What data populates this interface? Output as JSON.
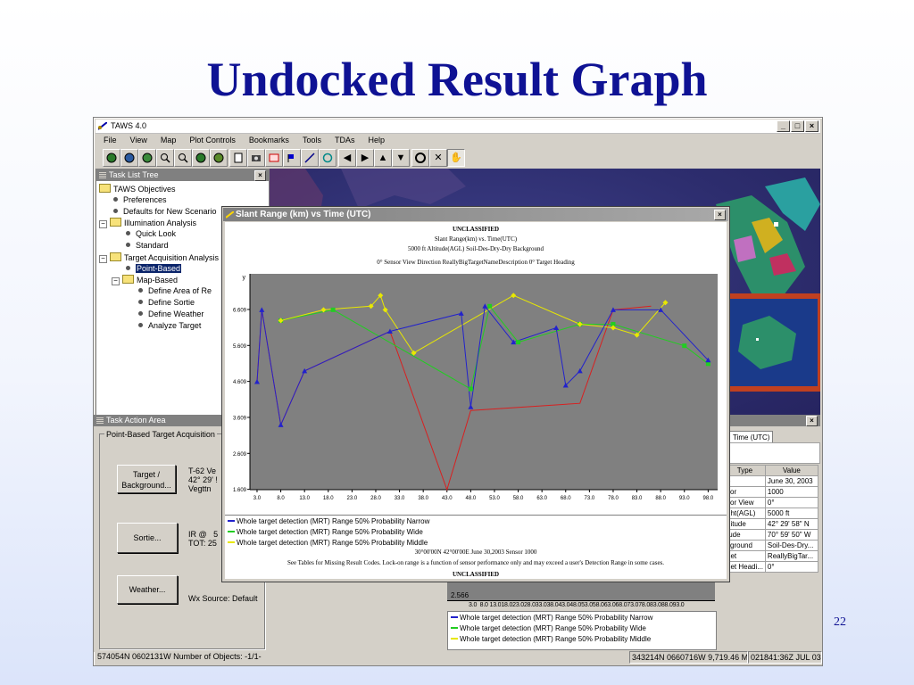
{
  "slide": {
    "title": "Undocked Result Graph",
    "page_number": "22"
  },
  "app": {
    "title": "TAWS 4.0",
    "menu": [
      "File",
      "View",
      "Map",
      "Plot Controls",
      "Bookmarks",
      "Tools",
      "TDAs",
      "Help"
    ],
    "toolbar_icons": [
      "globe-icon",
      "globe-icon",
      "globe-icon",
      "zoom-in-icon",
      "zoom-out-icon",
      "globe-icon",
      "globe-icon",
      "document-icon",
      "camera-icon",
      "measure-icon",
      "flag-icon",
      "arrow-line-icon",
      "circle-target-icon",
      "arrow-left-icon",
      "arrow-right-icon",
      "arrow-up-icon",
      "arrow-down-icon",
      "pan-cross-icon",
      "crosshair-icon",
      "hand-icon"
    ]
  },
  "task_list": {
    "title": "Task List Tree",
    "items": [
      {
        "label": "TAWS Objectives",
        "kind": "folder",
        "indent": 0
      },
      {
        "label": "Preferences",
        "kind": "leaf",
        "indent": 1
      },
      {
        "label": "Defaults for New Scenario",
        "kind": "leaf",
        "indent": 1
      },
      {
        "label": "Illumination Analysis",
        "kind": "folder-open",
        "indent": 0
      },
      {
        "label": "Quick Look",
        "kind": "leaf",
        "indent": 2
      },
      {
        "label": "Standard",
        "kind": "leaf",
        "indent": 2
      },
      {
        "label": "Target Acquisition Analysis",
        "kind": "folder-open",
        "indent": 0
      },
      {
        "label": "Point-Based",
        "kind": "leaf-selected",
        "indent": 2
      },
      {
        "label": "Map-Based",
        "kind": "folder-open",
        "indent": 1
      },
      {
        "label": "Define Area of Re",
        "kind": "leaf",
        "indent": 3
      },
      {
        "label": "Define Sortie",
        "kind": "leaf",
        "indent": 3
      },
      {
        "label": "Define Weather",
        "kind": "leaf",
        "indent": 3
      },
      {
        "label": "Analyze Target",
        "kind": "leaf",
        "indent": 3
      }
    ]
  },
  "task_action": {
    "title": "Task Action Area",
    "group_label": "Point-Based Target Acquisition",
    "target_button": "Target /\nBackground...",
    "target_info": "T-62 Ve\n42° 29' !\nVegttn",
    "sortie_button": "Sortie...",
    "sortie_info": "IR @   5\nTOT: 25",
    "weather_button": "Weather...",
    "weather_info": "Wx Source: Default"
  },
  "docked_graph": {
    "tab_label": "Time (UTC)",
    "table_headers": [
      "Type",
      "Value"
    ],
    "rows": [
      [
        "e",
        "June 30, 2003"
      ],
      [
        "sor",
        "1000"
      ],
      [
        "sor View",
        "0°"
      ],
      [
        "ght(AGL)",
        "5000 ft"
      ],
      [
        "gitude",
        "42° 29' 58\" N"
      ],
      [
        "tude",
        "70° 59' 50\" W"
      ],
      [
        "kground",
        "Soil-Des-Dry..."
      ],
      [
        "get",
        "ReallyBigTar..."
      ],
      [
        "get Headi...",
        "0°"
      ]
    ],
    "y_tick": "2.566",
    "x_ticks": "3.0  8.0 13.018.023.028.033.038.043.048.053.058.063.068.073.078.083.088.093.0",
    "legend": [
      "Whole target detection (MRT) Range  50% Probability  Narrow",
      "Whole target detection (MRT) Range  50% Probability  Wide",
      "Whole target detection (MRT) Range  50% Probability  Middle"
    ]
  },
  "graph_window": {
    "title": "Slant Range (km) vs Time (UTC)",
    "classification_top": "UNCLASSIFIED",
    "header_lines": [
      "Slant Range(km) vs. Time(UTC)",
      "5000 ft Altitude(AGL) Soil-Des-Dry-Dry Background",
      "0° Sensor View Direction ReallyBigTargetNameDescription 0° Target Heading"
    ],
    "footer_lines": [
      "30°00'00N 42°00'00E June 30,2003 Sensor 1000",
      "See Tables for Missing Result Codes. Lock-on range is a function of sensor performance only and may exceed a user's Detection Range in some cases."
    ],
    "classification_bottom": "UNCLASSIFIED",
    "y_axis_symbol": "y"
  },
  "chart_data": {
    "type": "line",
    "title": "Slant Range(km) vs. Time(UTC)",
    "xlabel": "",
    "ylabel": "y",
    "xlim": [
      1.5,
      100
    ],
    "ylim": [
      1.6,
      7.6
    ],
    "x_ticks": [
      3.0,
      8.0,
      13.0,
      18.0,
      23.0,
      28.0,
      33.0,
      38.0,
      43.0,
      48.0,
      53.0,
      58.0,
      63.0,
      68.0,
      73.0,
      78.0,
      83.0,
      88.0,
      93.0,
      98.0
    ],
    "x_tick_labels": [
      "3.0",
      "8.0",
      "13.0",
      "18.0",
      "23.0",
      "28.0",
      "33.0",
      "38.0",
      "43.0",
      "48.0",
      "53.0",
      "58.0",
      "63.0",
      "68.0",
      "73.0",
      "78.0",
      "83.0",
      "88.0",
      "93.0",
      "98.0"
    ],
    "y_ticks": [
      1.609,
      2.609,
      3.609,
      4.609,
      5.609,
      6.609
    ],
    "y_tick_labels": [
      "1.609",
      "2.609",
      "3.609",
      "4.609",
      "5.609",
      "6.609"
    ],
    "grid": false,
    "legend_position": "bottom",
    "colors": {
      "narrow": "#2222cc",
      "wide": "#22cc22",
      "middle": "#e8e800",
      "red_trace": "#d82020",
      "plot_bg": "#808080"
    },
    "series": [
      {
        "name": "Whole target detection (MRT) Range  50% Probability  Narrow",
        "color": "#2222cc",
        "marker": "triangle",
        "x": [
          3.0,
          4.0,
          8.0,
          13.0,
          31.0,
          46.0,
          48.0,
          51.0,
          57.0,
          66.0,
          68.0,
          71.0,
          78.0,
          88.0,
          98.0
        ],
        "y": [
          4.6,
          6.6,
          3.4,
          4.9,
          6.0,
          6.5,
          3.9,
          6.7,
          5.7,
          6.1,
          4.5,
          4.9,
          6.6,
          6.6,
          5.2
        ]
      },
      {
        "name": "Whole target detection (MRT) Range  50% Probability  Wide",
        "color": "#22cc22",
        "marker": "square",
        "x": [
          8.0,
          19.0,
          48.0,
          52.0,
          58.0,
          71.0,
          78.0,
          93.0,
          98.0
        ],
        "y": [
          6.3,
          6.6,
          4.4,
          6.7,
          5.7,
          6.2,
          6.2,
          5.6,
          5.1
        ]
      },
      {
        "name": "Whole target detection (MRT) Range  50% Probability  Middle",
        "color": "#e8e800",
        "marker": "diamond",
        "x": [
          8.0,
          17.0,
          27.0,
          29.0,
          30.0,
          36.0,
          57.0,
          71.0,
          78.0,
          83.0,
          89.0
        ],
        "y": [
          6.3,
          6.6,
          6.7,
          7.0,
          6.6,
          5.4,
          7.0,
          6.2,
          6.1,
          5.9,
          6.8
        ]
      },
      {
        "name": "",
        "color": "#d82020",
        "marker": "none",
        "x": [
          3.0,
          4.0,
          8.0,
          13.0,
          31.0,
          43.0,
          48.0,
          71.0,
          78.0,
          86.0
        ],
        "y": [
          4.6,
          6.6,
          3.4,
          4.9,
          6.0,
          1.6,
          3.8,
          4.0,
          6.6,
          6.7
        ]
      }
    ]
  }
}
